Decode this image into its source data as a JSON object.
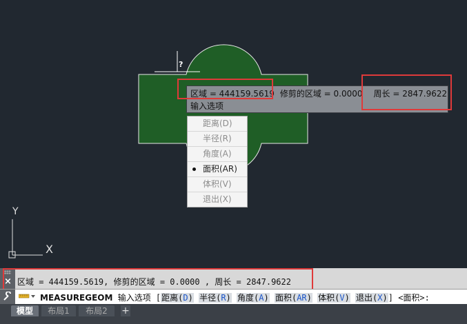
{
  "canvas": {
    "cursor_hint": "?",
    "ucs": {
      "y_label": "Y",
      "x_label": "X"
    }
  },
  "tooltip": {
    "area": "区域 = 444159.5619",
    "trimmed_area": "修剪的区域 = 0.0000",
    "perimeter": "周长 = 2847.9622",
    "prompt": "输入选项"
  },
  "context_menu": {
    "items": [
      {
        "label": "距离(D)"
      },
      {
        "label": "半径(R)"
      },
      {
        "label": "角度(A)"
      },
      {
        "label": "面积(AR)",
        "selected": true
      },
      {
        "label": "体积(V)"
      },
      {
        "label": "退出(X)"
      }
    ]
  },
  "command_history": {
    "close_icon": "×",
    "text": "区域 = 444159.5619, 修剪的区域 = 0.0000 , 周长 = 2847.9622"
  },
  "command_line": {
    "command": "MEASUREGEOM",
    "prompt": "输入选项 [",
    "options": [
      {
        "name": "距离(",
        "key": "D",
        "close": ")"
      },
      {
        "name": "半径(",
        "key": "R",
        "close": ")"
      },
      {
        "name": "角度(",
        "key": "A",
        "close": ")"
      },
      {
        "name": "面积(",
        "key": "AR",
        "close": ")"
      },
      {
        "name": "体积(",
        "key": "V",
        "close": ")"
      },
      {
        "name": "退出(",
        "key": "X",
        "close": ")"
      }
    ],
    "suffix": "] <面积>:"
  },
  "tabs": {
    "items": [
      "模型",
      "布局1",
      "布局2"
    ],
    "add": "+"
  },
  "colors": {
    "canvas_bg": "#212830",
    "shape_fill": "#1f5e26",
    "highlight": "#e03a3a"
  }
}
